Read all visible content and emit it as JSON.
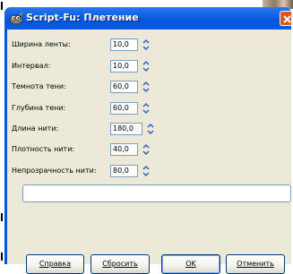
{
  "window": {
    "title": "Script-Fu: Плетение",
    "accent": "#0054e3",
    "client_bg": "#ece9d8"
  },
  "icons": {
    "app": "gimp-wilber-icon",
    "close": "close-icon",
    "spin": "spin-arrows-icon"
  },
  "fields": [
    {
      "label": "Ширина ленты:",
      "value": "10,0"
    },
    {
      "label": "Интервал:",
      "value": "10,0"
    },
    {
      "label": "Темнота тени:",
      "value": "60,0"
    },
    {
      "label": "Глубина тени:",
      "value": "60,0"
    },
    {
      "label": "Длина нити:",
      "value": "180,0"
    },
    {
      "label": "Плотность нити:",
      "value": "40,0"
    },
    {
      "label": "Непрозрачность нити:",
      "value": "80,0"
    }
  ],
  "progress_text": "",
  "buttons": {
    "help": "Справка",
    "reset": "Сбросить",
    "ok": "OK",
    "cancel": "Отменить"
  }
}
